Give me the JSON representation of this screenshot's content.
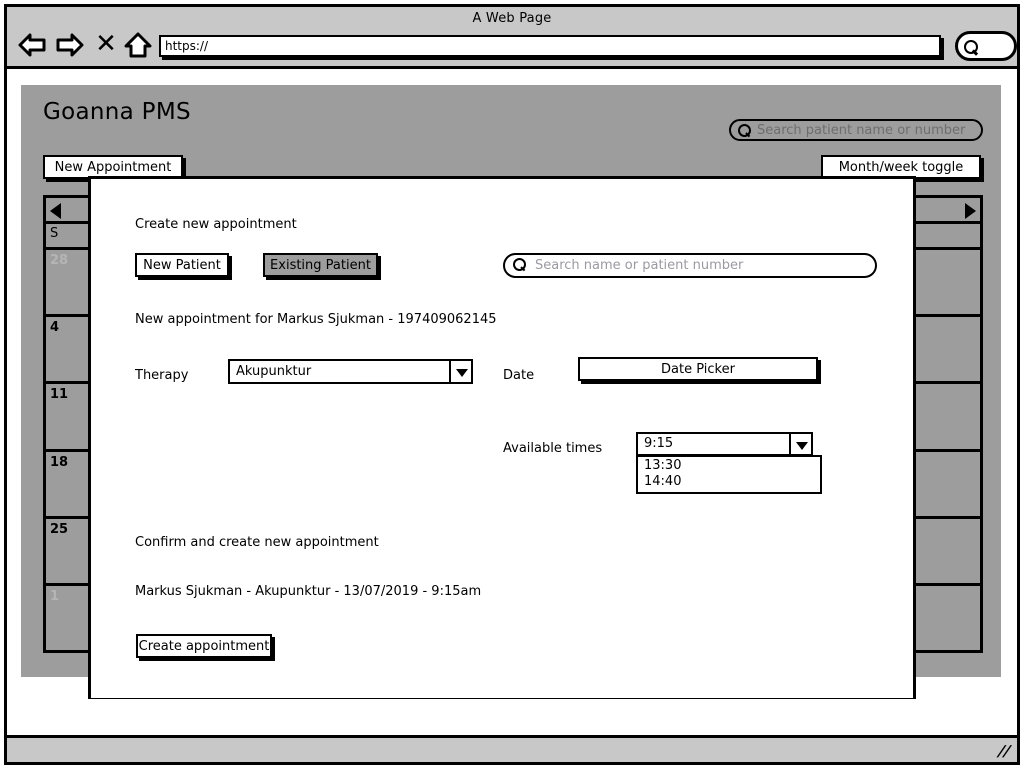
{
  "browser": {
    "window_title": "A Web Page",
    "url_value": "https://",
    "back_icon": "back-arrow-icon",
    "forward_icon": "forward-arrow-icon",
    "stop_icon": "close-x-icon",
    "home_icon": "home-icon",
    "search_icon": "search-icon"
  },
  "app": {
    "title": "Goanna PMS",
    "patient_search_placeholder": "Search patient name or number",
    "new_appointment_label": "New Appointment",
    "month_week_toggle_label": "Month/week toggle"
  },
  "calendar": {
    "prev_arrow": "arrow-left-icon",
    "next_arrow": "arrow-right-icon",
    "columns": [
      {
        "dayname": "S",
        "dates": [
          "28",
          "4",
          "11",
          "18",
          "25",
          "1"
        ],
        "muted": [
          true,
          false,
          false,
          false,
          false,
          true
        ]
      },
      {
        "dayname": "",
        "dates": [
          "",
          "",
          "",
          "",
          "",
          ""
        ],
        "muted": [
          false,
          false,
          false,
          false,
          false,
          false
        ]
      },
      {
        "dayname": "",
        "dates": [
          "",
          "",
          "",
          "",
          "",
          ""
        ],
        "muted": [
          false,
          false,
          false,
          false,
          false,
          false
        ]
      },
      {
        "dayname": "",
        "dates": [
          "",
          "",
          "",
          "",
          "",
          ""
        ],
        "muted": [
          false,
          false,
          false,
          false,
          false,
          false
        ]
      },
      {
        "dayname": "",
        "dates": [
          "",
          "",
          "",
          "",
          "",
          ""
        ],
        "muted": [
          false,
          false,
          false,
          false,
          false,
          false
        ]
      },
      {
        "dayname": "",
        "dates": [
          "",
          "",
          "",
          "",
          "",
          ""
        ],
        "muted": [
          false,
          false,
          false,
          false,
          false,
          false
        ]
      },
      {
        "dayname": "",
        "dates": [
          "",
          "",
          "",
          "",
          "",
          ""
        ],
        "muted": [
          false,
          false,
          false,
          false,
          false,
          false
        ]
      }
    ]
  },
  "modal": {
    "title": "Create new appointment",
    "new_patient_label": "New Patient",
    "existing_patient_label": "Existing Patient",
    "existing_patient_selected": true,
    "search_placeholder": "Search name or patient number",
    "appointment_for": "New appointment for Markus Sjukman - 197409062145",
    "therapy_label": "Therapy",
    "therapy_value": "Akupunktur",
    "date_label": "Date",
    "date_picker_label": "Date Picker",
    "available_times_label": "Available times",
    "available_times_value": "9:15",
    "available_times_options": [
      "13:30",
      "14:40"
    ],
    "confirm_heading": "Confirm and create new appointment",
    "summary": "Markus Sjukman - Akupunktur - 13/07/2019 - 9:15am",
    "create_button_label": "Create appointment"
  },
  "status_bar": {
    "resize_grip": "resize-grip-icon"
  },
  "colors": {
    "app_background": "#9d9d9d",
    "chrome": "#c8c8c8",
    "ink": "#000000",
    "muted_text": "#b5b5b5"
  }
}
